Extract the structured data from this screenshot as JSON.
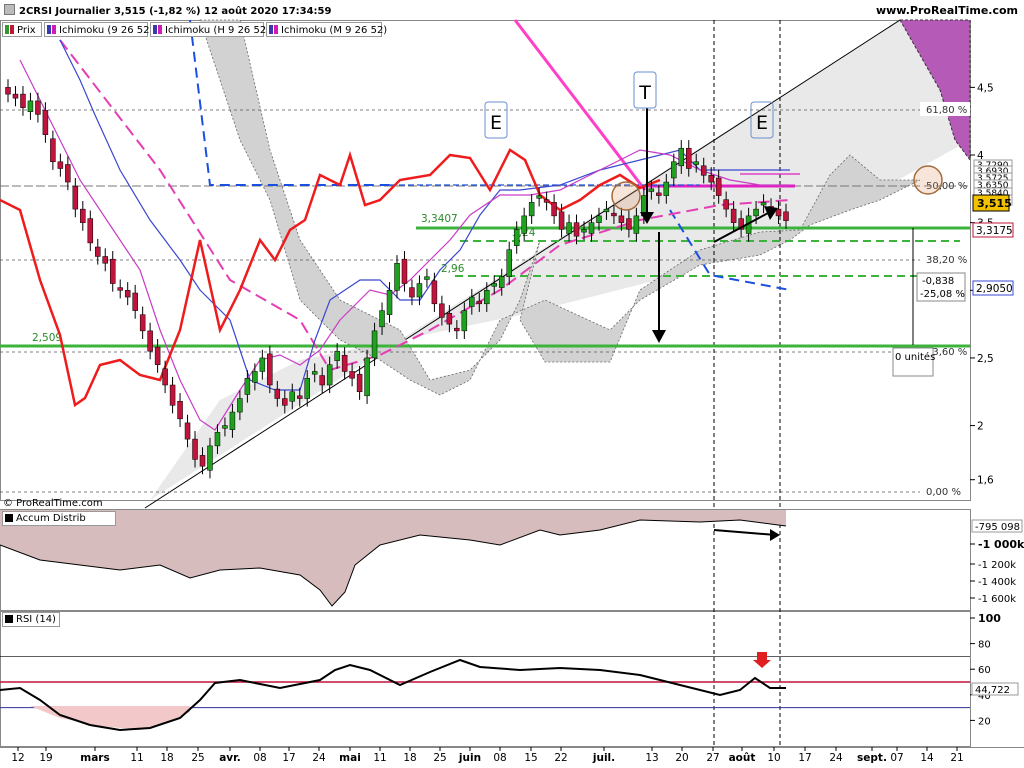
{
  "header": {
    "title": "2CRSI Journalier 3,515 (-1,82 %) 12 août 2020 17:34:59",
    "site": "www.ProRealTime.com"
  },
  "legend": [
    {
      "label": "Prix",
      "colors": [
        "#2e9a2e",
        "#c0143c"
      ]
    },
    {
      "label": "Ichimoku (9 26 52)",
      "colors": [
        "#3a3ab0",
        "#d21ab4"
      ]
    },
    {
      "label": "Ichimoku (H 9 26 52)",
      "colors": [
        "#3a3ab0",
        "#d21ab4"
      ]
    },
    {
      "label": "Ichimoku (M 9 26 52)",
      "colors": [
        "#3a3ab0",
        "#d21ab4"
      ]
    }
  ],
  "copyright": "© ProRealTime.com",
  "annotations": {
    "T": "T",
    "E1": "E",
    "E2": "E"
  },
  "price_axis": {
    "ticks": [
      "4,5",
      "4",
      "3,5",
      "3",
      "2,5",
      "2",
      "1,6"
    ],
    "badges": {
      "last": "3,515",
      "tenkan": "3,3175",
      "kijun": "2,9050",
      "stack": [
        "3,7290",
        "3,6930",
        "3,5725",
        "3,6350",
        "3,5840",
        "3,5750"
      ]
    }
  },
  "fibo": {
    "levels": [
      "61,80 %",
      "50,00 %",
      "38,20 %",
      "23,60 %",
      "0,00 %"
    ],
    "loss_value": "-0,838",
    "loss_pct": "-25,08 %",
    "units": "0 unités"
  },
  "levels": {
    "upper": "3,3407",
    "mid": "3,24",
    "low_tag": "2,96",
    "support": "2,509"
  },
  "accum": {
    "title": "Accum Distrib",
    "value": "-795 098",
    "ticks": [
      "-1 000k",
      "-1 200k",
      "-1 400k",
      "-1 600k"
    ]
  },
  "rsi": {
    "title": "RSI (14)",
    "value": "44,722",
    "ticks": [
      "100",
      "80",
      "60",
      "40",
      "20"
    ]
  },
  "xaxis": [
    {
      "label": "12",
      "bold": false
    },
    {
      "label": "19",
      "bold": false
    },
    {
      "label": "mars",
      "bold": true
    },
    {
      "label": "11",
      "bold": false
    },
    {
      "label": "18",
      "bold": false
    },
    {
      "label": "25",
      "bold": false
    },
    {
      "label": "avr.",
      "bold": true
    },
    {
      "label": "08",
      "bold": false
    },
    {
      "label": "17",
      "bold": false
    },
    {
      "label": "24",
      "bold": false
    },
    {
      "label": "mai",
      "bold": true
    },
    {
      "label": "11",
      "bold": false
    },
    {
      "label": "18",
      "bold": false
    },
    {
      "label": "25",
      "bold": false
    },
    {
      "label": "juin",
      "bold": true
    },
    {
      "label": "08",
      "bold": false
    },
    {
      "label": "15",
      "bold": false
    },
    {
      "label": "22",
      "bold": false
    },
    {
      "label": "juil.",
      "bold": true
    },
    {
      "label": "13",
      "bold": false
    },
    {
      "label": "20",
      "bold": false
    },
    {
      "label": "27",
      "bold": false
    },
    {
      "label": "août",
      "bold": true
    },
    {
      "label": "10",
      "bold": false
    },
    {
      "label": "17",
      "bold": false
    },
    {
      "label": "24",
      "bold": false
    },
    {
      "label": "sept.",
      "bold": true
    },
    {
      "label": "07",
      "bold": false
    },
    {
      "label": "14",
      "bold": false
    },
    {
      "label": "21",
      "bold": false
    }
  ],
  "chart_data": {
    "type": "candlestick",
    "symbol": "2CRSI",
    "period": "Journalier",
    "last": 3.515,
    "change_pct": -1.82,
    "y_range": [
      1.45,
      4.85
    ],
    "ohlc_close_series": [
      4.45,
      4.42,
      4.35,
      4.4,
      4.3,
      4.15,
      3.95,
      3.9,
      3.8,
      3.6,
      3.5,
      3.35,
      3.25,
      3.2,
      3.05,
      3.0,
      2.95,
      2.85,
      2.7,
      2.55,
      2.45,
      2.3,
      2.15,
      2.05,
      1.9,
      1.75,
      1.7,
      1.85,
      1.95,
      2.0,
      2.1,
      2.2,
      2.35,
      2.4,
      2.5,
      2.3,
      2.2,
      2.15,
      2.25,
      2.2,
      2.35,
      2.4,
      2.3,
      2.45,
      2.55,
      2.4,
      2.35,
      2.25,
      2.5,
      2.7,
      2.85,
      3.0,
      3.2,
      3.05,
      2.95,
      3.05,
      3.1,
      2.9,
      2.8,
      2.75,
      2.7,
      2.85,
      2.95,
      2.9,
      3.0,
      3.05,
      3.1,
      3.3,
      3.45,
      3.55,
      3.65,
      3.7,
      3.65,
      3.55,
      3.45,
      3.5,
      3.4,
      3.45,
      3.5,
      3.55,
      3.6,
      3.55,
      3.5,
      3.45,
      3.55,
      3.7,
      3.75,
      3.7,
      3.8,
      3.95,
      4.05,
      3.9,
      3.95,
      3.85,
      3.8,
      3.7,
      3.6,
      3.5,
      3.45,
      3.55,
      3.6,
      3.65,
      3.6,
      3.55,
      3.515
    ],
    "levels": {
      "resistance_upper": 3.3407,
      "mid": 3.24,
      "support": 2.509
    },
    "fibonacci": {
      "61.8%": 4.18,
      "50%": 3.64,
      "38.2%": 3.24,
      "23.6%": 2.5,
      "0%": 1.47
    },
    "rsi_last": 44.722,
    "rsi_levels": [
      70,
      50,
      30
    ],
    "accum_distrib_last": -795098
  }
}
